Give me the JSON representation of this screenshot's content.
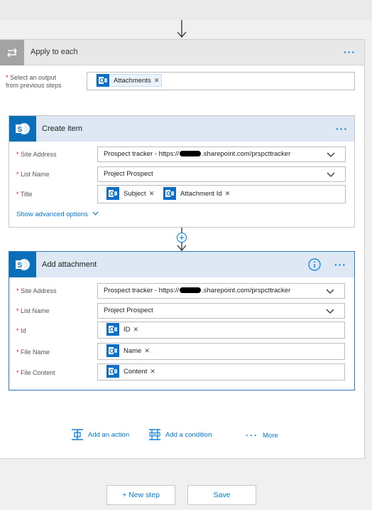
{
  "apply_to_each": {
    "title": "Apply to each",
    "select_label_line1": "Select an output",
    "select_label_line2": "from previous steps",
    "token": "Attachments"
  },
  "create_item": {
    "title": "Create item",
    "site_address_label": "Site Address",
    "site_address_value_prefix": "Prospect tracker - https://",
    "site_address_value_suffix": ".sharepoint.com/prspcttracker",
    "list_name_label": "List Name",
    "list_name_value": "Project Prospect",
    "title_label": "Title",
    "title_tokens": [
      "Subject",
      "Attachment Id"
    ],
    "advanced_options": "Show advanced options"
  },
  "add_attachment": {
    "title": "Add attachment",
    "site_address_label": "Site Address",
    "site_address_value_prefix": "Prospect tracker - https://",
    "site_address_value_suffix": ".sharepoint.com/prspcttracker",
    "list_name_label": "List Name",
    "list_name_value": "Project Prospect",
    "id_label": "Id",
    "id_token": "ID",
    "file_name_label": "File Name",
    "file_name_token": "Name",
    "file_content_label": "File Content",
    "file_content_token": "Content"
  },
  "actions": {
    "add_action": "Add an action",
    "add_condition": "Add a condition",
    "more": "More"
  },
  "footer": {
    "new_step": "+ New step",
    "save": "Save"
  },
  "icons": {
    "loop": "loop-icon",
    "sharepoint": "sharepoint-icon",
    "outlook": "outlook-icon",
    "info": "info-icon",
    "chevron": "chevron-down-icon"
  },
  "colors": {
    "accent": "#0078d7",
    "sharepoint_blue": "#0a6fb8",
    "card_header": "#dde8f4",
    "loop_header": "#e8e8e8",
    "required": "#e81123"
  }
}
